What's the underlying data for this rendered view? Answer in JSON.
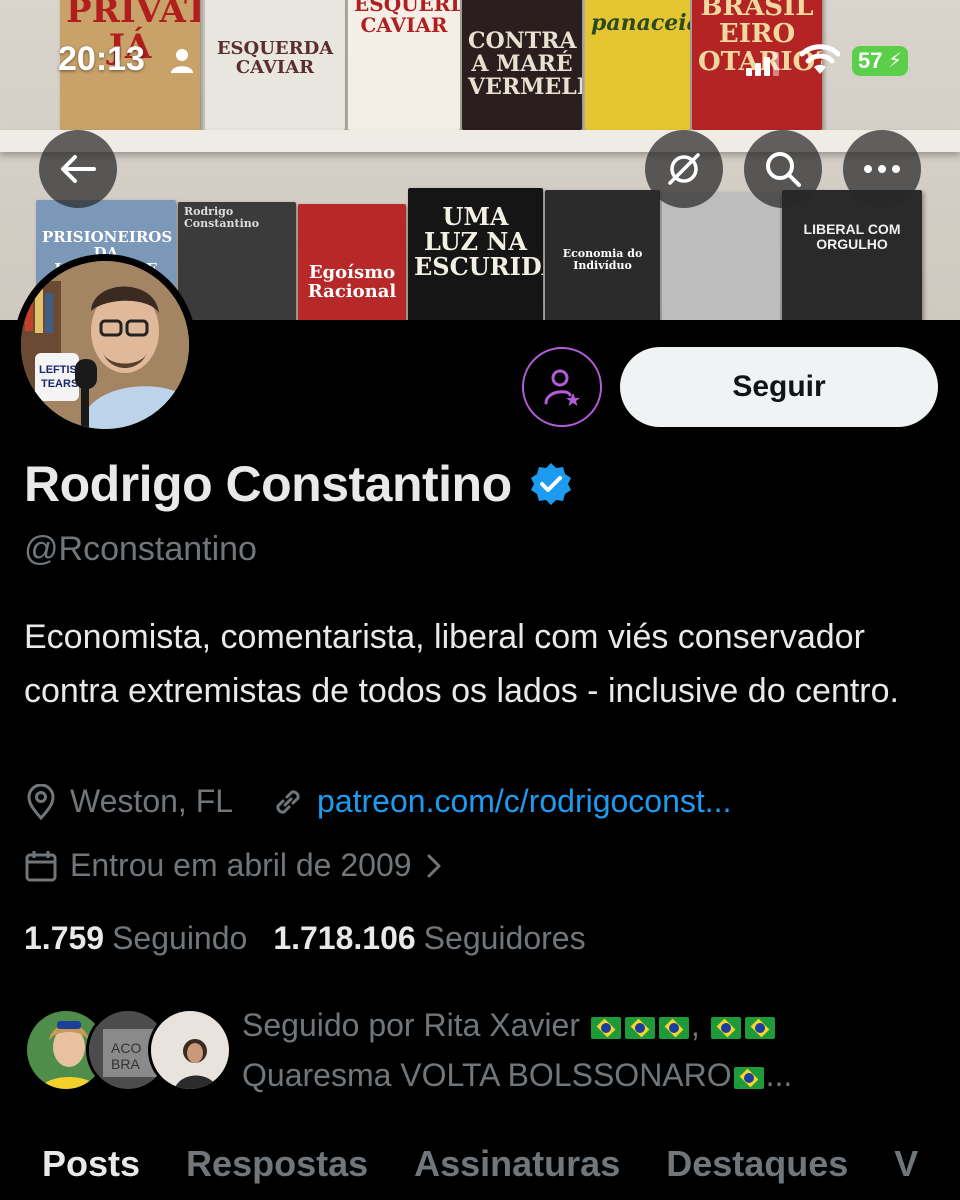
{
  "status_bar": {
    "time": "20:13",
    "battery": "57"
  },
  "banner": {
    "books_top": [
      "PRIVATIZE JÁ",
      "ESQUERDA CAVIAR",
      "ESQUERDA CAVIAR",
      "CONTRA A MARÉ VERMELHA",
      "panaceia",
      "BRASIL EIRO OTARIO?"
    ],
    "books_bottom": [
      "PRISIONEIROS DA LIBERDADE",
      "Rodrigo Constantino",
      "Egoísmo Racional",
      "UMA LUZ NA ESCURIDÃO",
      "Economia do Indivíduo",
      "LIBERAL COM ORGULHO"
    ]
  },
  "profile": {
    "name": "Rodrigo Constantino",
    "handle": "@Rconstantino",
    "bio": "Economista, comentarista, liberal com viés conservador contra extremistas de todos os lados - inclusive do centro.",
    "location": "Weston, FL",
    "website": "patreon.com/c/rodrigoconst...",
    "joined": "Entrou em abril de 2009",
    "following_count": "1.759",
    "following_label": "Seguindo",
    "followers_count": "1.718.106",
    "followers_label": "Seguidores",
    "follow_button": "Seguir"
  },
  "followed_by": {
    "line1": "Seguido por Rita Xavier",
    "line2": "Quaresma VOLTA BOLSSONARO",
    "ellipsis": "..."
  },
  "tabs": [
    {
      "label": "Posts",
      "active": true
    },
    {
      "label": "Respostas",
      "active": false
    },
    {
      "label": "Assinaturas",
      "active": false
    },
    {
      "label": "Destaques",
      "active": false
    },
    {
      "label": "V",
      "active": false
    }
  ],
  "colors": {
    "accent": "#1d9bf0",
    "verified": "#1d9bf0",
    "notify_ring": "#b35cd9"
  }
}
